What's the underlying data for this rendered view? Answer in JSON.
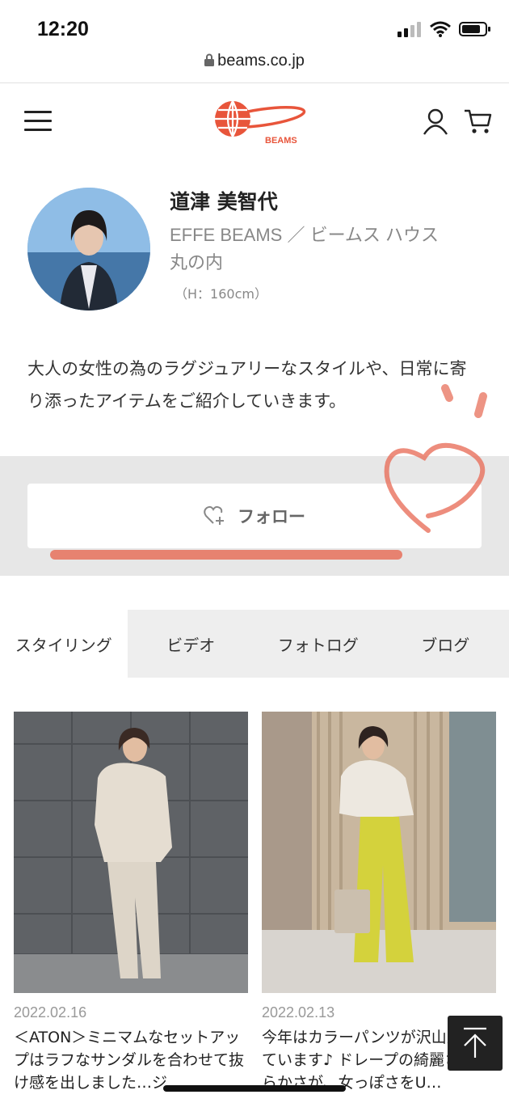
{
  "status_bar": {
    "time": "12:20"
  },
  "browser": {
    "url": "beams.co.jp"
  },
  "header": {
    "brand": "BEAMS"
  },
  "profile": {
    "name": "道津 美智代",
    "shop_line1": "EFFE BEAMS ／ ビームス ハウス",
    "shop_line2": "丸の内",
    "height": "（H：160cm）",
    "bio": "大人の女性の為のラグジュアリーなスタイルや、日常に寄り添ったアイテムをご紹介していきます。"
  },
  "follow": {
    "label": "フォロー"
  },
  "tabs": [
    {
      "label": "スタイリング",
      "active": true
    },
    {
      "label": "ビデオ",
      "active": false
    },
    {
      "label": "フォトログ",
      "active": false
    },
    {
      "label": "ブログ",
      "active": false
    }
  ],
  "stylings": [
    {
      "date": "2022.02.16",
      "caption": "＜ATON＞ミニマムなセットアップはラフなサンダルを合わせて抜け感を出しました…ジ"
    },
    {
      "date": "2022.02.13",
      "caption": "今年はカラーパンツが沢山入荷しています♪ ドレープの綺麗さと柔らかさが、女っぽさをU…"
    }
  ],
  "colors": {
    "brand": "#e8553b",
    "deco": "#e8715c",
    "tab_bg": "#eeeeee",
    "band_bg": "#e7e7e7"
  }
}
